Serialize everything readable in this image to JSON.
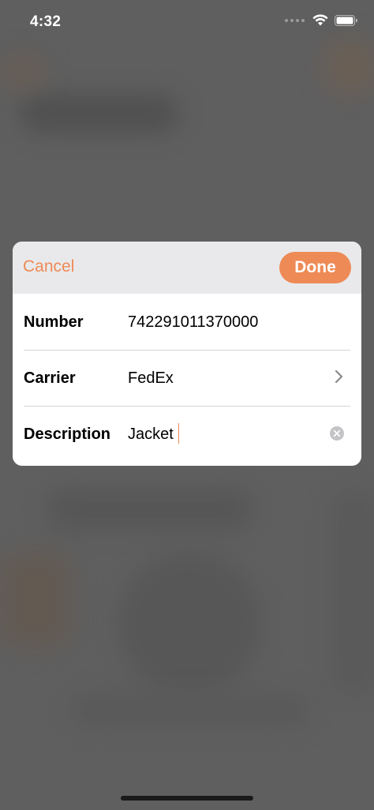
{
  "status_bar": {
    "time": "4:32"
  },
  "modal": {
    "cancel_label": "Cancel",
    "done_label": "Done",
    "fields": [
      {
        "label": "Number",
        "value": "742291011370000"
      },
      {
        "label": "Carrier",
        "value": "FedEx"
      },
      {
        "label": "Description",
        "value": "Jacket"
      }
    ]
  },
  "icons": {
    "carrier_chevron": "chevron-right-icon",
    "clear": "clear-circle-icon",
    "wifi": "wifi-icon",
    "battery": "battery-icon"
  },
  "colors": {
    "accent": "#ee8a55",
    "overlay": "#5f5f5f",
    "header_bg": "#e9e9eb"
  }
}
